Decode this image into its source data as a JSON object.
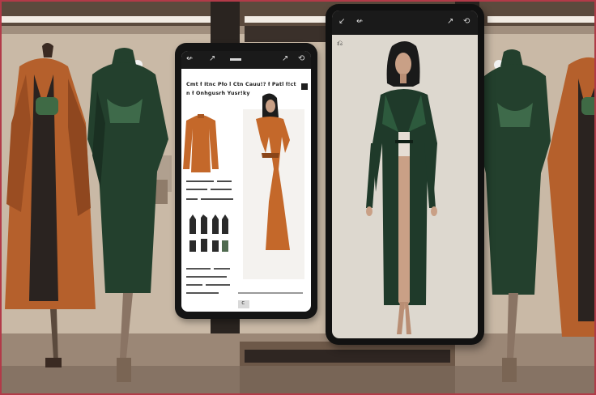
{
  "colors": {
    "frame": "#b23a48",
    "wall": "#c9b9a6",
    "rust": "#b5602c",
    "forest": "#23402d",
    "dark": "#141414",
    "screen_bg_detail": "#ffffff",
    "screen_bg_fullview": "#ddd8cf"
  },
  "product_app": {
    "status_icons": [
      "back-arrow-icon",
      "edit-icon",
      "share-icon",
      "refresh-icon"
    ],
    "headline": "Cmt ł Itnc Pło l Ctn Cauu!? ł Patl ł!ct\nn ł Onhgusrh Yusr!ky",
    "footer_button": "c"
  },
  "fullview_app": {
    "status_icons": [
      "collapse-icon",
      "back-arrow-icon",
      "crop-icon",
      "refresh-icon"
    ],
    "side_icon": "power-icon"
  }
}
